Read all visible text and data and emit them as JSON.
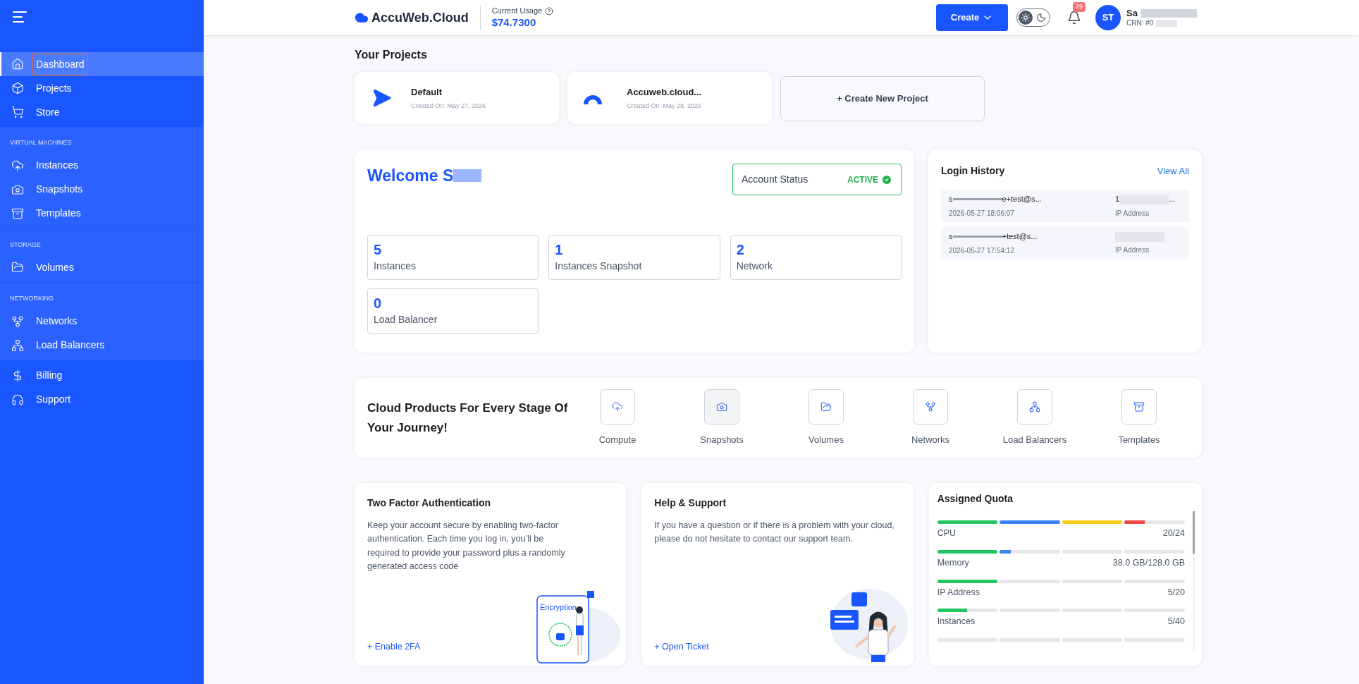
{
  "sidebar": {
    "groups": [
      {
        "items": [
          {
            "label": "Dashboard",
            "selected": true
          },
          {
            "label": "Projects",
            "selected": false
          },
          {
            "label": "Store",
            "selected": false
          }
        ]
      },
      {
        "heading": "VIRTUAL MACHINES",
        "items": [
          {
            "label": "Instances",
            "selected": false
          },
          {
            "label": "Snapshots",
            "selected": false
          },
          {
            "label": "Templates",
            "selected": false
          }
        ]
      },
      {
        "heading": "STORAGE",
        "items": [
          {
            "label": "Volumes",
            "selected": false
          }
        ]
      },
      {
        "heading": "NETWORKING",
        "items": [
          {
            "label": "Networks",
            "selected": false
          },
          {
            "label": "Load Balancers",
            "selected": false
          }
        ]
      },
      {
        "items": [
          {
            "label": "Billing",
            "selected": false
          },
          {
            "label": "Support",
            "selected": false
          }
        ]
      }
    ]
  },
  "header": {
    "logo": "AccuWeb.Cloud",
    "usage_label": "Current Usage",
    "usage_value": "$74.7300",
    "create_button": "Create",
    "dark_mode": false,
    "notifications": "29",
    "avatar": "ST",
    "user_name": "Sa",
    "crn": "CRN: #0"
  },
  "projects": {
    "title": "Your Projects",
    "items": [
      {
        "kind": "send",
        "name": "Default",
        "created": "Created On: May 27, 2026"
      },
      {
        "kind": "arc",
        "name": "Accuweb.cloud...",
        "created": "Created On: May 28, 2026"
      }
    ],
    "create": "+ Create New Project"
  },
  "welcome": {
    "greeting": "Welcome S",
    "status_label": "Account Status",
    "status": "ACTIVE",
    "stats": [
      {
        "value": "5",
        "label": "Instances"
      },
      {
        "value": "1",
        "label": "Instances Snapshot"
      },
      {
        "value": "2",
        "label": "Network"
      },
      {
        "value": "0",
        "label": "Load Balancer"
      }
    ]
  },
  "login_history": {
    "title": "Login History",
    "view_all": "View All",
    "rows": [
      {
        "email_start": "s",
        "email_end": "e+test@s...",
        "time": "2026-05-27 18:06:07",
        "ip": "1",
        "ip_end": "...",
        "ip_label": "IP Address"
      },
      {
        "email_start": "s",
        "email_end": "+test@s...",
        "time": "2026-05-27 17:54:12",
        "ip": "",
        "ip_end": "",
        "ip_label": "IP Address"
      }
    ]
  },
  "products": {
    "title": "Cloud Products For Every Stage Of Your Journey!",
    "items": [
      {
        "label": "Compute",
        "selected": false
      },
      {
        "label": "Snapshots",
        "selected": true
      },
      {
        "label": "Volumes",
        "selected": false
      },
      {
        "label": "Networks",
        "selected": false
      },
      {
        "label": "Load Balancers",
        "selected": false
      },
      {
        "label": "Templates",
        "selected": false
      }
    ]
  },
  "two_factor": {
    "title": "Two Factor Authentication",
    "text": "Keep your account secure by enabling two-factor authentication. Each time you log in, you’ll be required to provide your password plus a randomly generated access code",
    "link": "+ Enable 2FA",
    "illustration_label": "Encryption"
  },
  "help": {
    "title": "Help & Support",
    "text": "If you have a question or if there is a problem with your cloud, please do not hesitate to contact our support team.",
    "link": "+ Open Ticket"
  },
  "quota": {
    "title": "Assigned Quota",
    "rows": [
      {
        "label": "CPU",
        "value": "20/24",
        "level": 0.833
      },
      {
        "label": "Memory",
        "value": "38.0 GB/128.0 GB",
        "level": 0.297
      },
      {
        "label": "IP Address",
        "value": "5/20",
        "level": 0.25
      },
      {
        "label": "Instances",
        "value": "5/40",
        "level": 0.125
      }
    ]
  }
}
